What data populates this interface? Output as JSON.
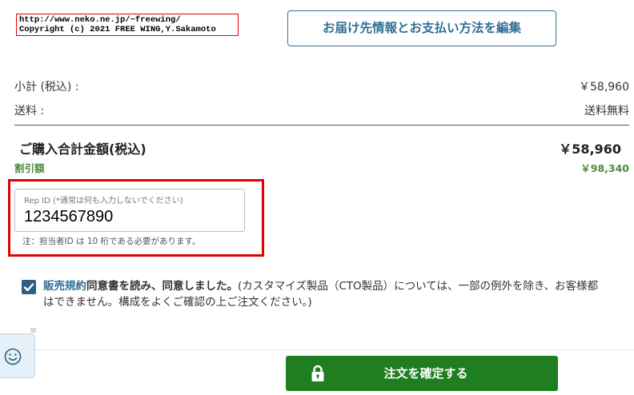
{
  "copyright": {
    "line1": "http://www.neko.ne.jp/~freewing/",
    "line2": "Copyright (c) 2021 FREE WING,Y.Sakamoto"
  },
  "header": {
    "edit_button_label": "お届け先情報とお支払い方法を編集"
  },
  "summary": {
    "subtotal_label": "小計 (税込) :",
    "subtotal_value": "￥58,960",
    "shipping_label": "送料 :",
    "shipping_value": "送料無料",
    "total_label": "ご購入合計金額(税込)",
    "total_value": "￥58,960",
    "discount_label": "割引額",
    "discount_value": "￥98,340"
  },
  "rep_id": {
    "label": "Rep ID (*通常は何も入力しないでください)",
    "value": "1234567890",
    "note": "注：担当者ID は 10 桁である必要があります。"
  },
  "agreement": {
    "checked": true,
    "link": "販売規約",
    "bold_text": "同意書を読み、同意しました。",
    "text": "(カスタマイズ製品（CTO製品）については、一部の例外を除き、お客様都",
    "text_line2": "はできません。構成をよくご確認の上ご注文ください。)"
  },
  "footer": {
    "confirm_button_label": "注文を確定する"
  },
  "icons": {
    "chat": "smiley-face-icon",
    "lock": "lock-icon",
    "check": "checkmark-icon"
  },
  "colors": {
    "accent_blue": "#2f6f96",
    "confirm_green": "#1f7e1f",
    "discount_green": "#4f8a3c",
    "highlight_red": "#e00000"
  }
}
